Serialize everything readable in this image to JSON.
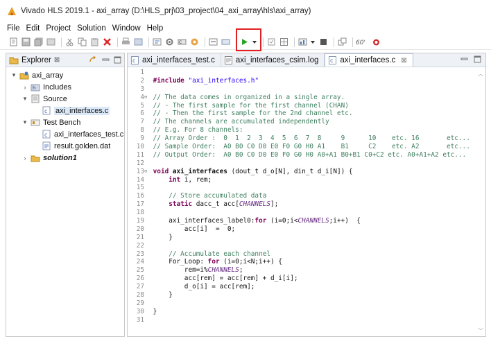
{
  "window": {
    "title": "Vivado HLS 2019.1 - axi_array (D:\\HLS_prj\\03_project\\04_axi_array\\hls\\axi_array)"
  },
  "menu": [
    "File",
    "Edit",
    "Project",
    "Solution",
    "Window",
    "Help"
  ],
  "colors": {
    "highlight": "#e02020",
    "run": "#2aa52a",
    "comment": "#3f7f5f",
    "keyword": "#7f0055",
    "string": "#2a00ff"
  },
  "toolbar": {
    "icons": [
      "new-file-icon",
      "save-icon",
      "save-all-icon",
      "properties-icon",
      "cut-icon",
      "copy-icon",
      "paste-icon",
      "delete-icon",
      "print-icon",
      "new-project-icon",
      "build-icon",
      "settings-icon",
      "synthesis-icon",
      "cosim-icon",
      "export-icon",
      "compare-icon",
      "run-icon",
      "dropdown-icon",
      "checkbox-icon",
      "grid-icon",
      "dashboard-icon",
      "dropdown-icon",
      "stop-icon",
      "perspective-icon",
      "debug-icon",
      "bug-icon"
    ]
  },
  "explorer": {
    "tab_label": "Explorer",
    "tree": [
      {
        "label": "axi_array",
        "level": 0,
        "arrow": "▾",
        "icon": "project-icon"
      },
      {
        "label": "Includes",
        "level": 1,
        "arrow": "›",
        "icon": "includes-icon"
      },
      {
        "label": "Source",
        "level": 1,
        "arrow": "▾",
        "icon": "source-folder-icon"
      },
      {
        "label": "axi_interfaces.c",
        "level": 2,
        "arrow": "",
        "icon": "c-file-icon",
        "selected": true
      },
      {
        "label": "Test Bench",
        "level": 1,
        "arrow": "▾",
        "icon": "testbench-folder-icon"
      },
      {
        "label": "axi_interfaces_test.c",
        "level": 2,
        "arrow": "",
        "icon": "c-file-icon"
      },
      {
        "label": "result.golden.dat",
        "level": 2,
        "arrow": "",
        "icon": "data-file-icon"
      },
      {
        "label": "solution1",
        "level": 1,
        "arrow": "›",
        "icon": "solution-folder-icon",
        "bold": true
      }
    ]
  },
  "editor": {
    "tabs": [
      {
        "label": "axi_interfaces_test.c",
        "active": false
      },
      {
        "label": "axi_interfaces_csim.log",
        "active": false
      },
      {
        "label": "axi_interfaces.c",
        "active": true
      }
    ],
    "lines": [
      {
        "n": "1",
        "t": ""
      },
      {
        "n": "2",
        "t": "#include \"axi_interfaces.h\""
      },
      {
        "n": "3",
        "t": ""
      },
      {
        "n": "4",
        "t": "// The data comes in organized in a single array.",
        "fold": true
      },
      {
        "n": "5",
        "t": "// - The first sample for the first channel (CHAN)"
      },
      {
        "n": "6",
        "t": "// - Then the first sample for the 2nd channel etc."
      },
      {
        "n": "7",
        "t": "// The channels are accumulated independently"
      },
      {
        "n": "8",
        "t": "// E.g. For 8 channels:"
      },
      {
        "n": "9",
        "t": "// Array Order :  0  1  2  3  4  5  6  7  8     9      10    etc. 16       etc..."
      },
      {
        "n": "10",
        "t": "// Sample Order:  A0 B0 C0 D0 E0 F0 G0 H0 A1    B1     C2    etc. A2       etc..."
      },
      {
        "n": "11",
        "t": "// Output Order:  A0 B0 C0 D0 E0 F0 G0 H0 A0+A1 B0+B1 C0+C2 etc. A0+A1+A2 etc..."
      },
      {
        "n": "12",
        "t": ""
      },
      {
        "n": "13",
        "t": "void axi_interfaces (dout_t d_o[N], din_t d_i[N]) {",
        "fold": true
      },
      {
        "n": "14",
        "t": "    int i, rem;"
      },
      {
        "n": "15",
        "t": ""
      },
      {
        "n": "16",
        "t": "    // Store accumulated data"
      },
      {
        "n": "17",
        "t": "    static dacc_t acc[CHANNELS];"
      },
      {
        "n": "18",
        "t": ""
      },
      {
        "n": "19",
        "t": "    axi_interfaces_label0:for (i=0;i<CHANNELS;i++)  {"
      },
      {
        "n": "20",
        "t": "        acc[i]  =  0;"
      },
      {
        "n": "21",
        "t": "    }"
      },
      {
        "n": "22",
        "t": ""
      },
      {
        "n": "23",
        "t": "    // Accumulate each channel"
      },
      {
        "n": "24",
        "t": "    For_Loop: for (i=0;i<N;i++) {"
      },
      {
        "n": "25",
        "t": "        rem=i%CHANNELS;"
      },
      {
        "n": "26",
        "t": "        acc[rem] = acc[rem] + d_i[i];"
      },
      {
        "n": "27",
        "t": "        d_o[i] = acc[rem];"
      },
      {
        "n": "28",
        "t": "    }"
      },
      {
        "n": "29",
        "t": ""
      },
      {
        "n": "30",
        "t": "}"
      },
      {
        "n": "31",
        "t": ""
      }
    ]
  }
}
